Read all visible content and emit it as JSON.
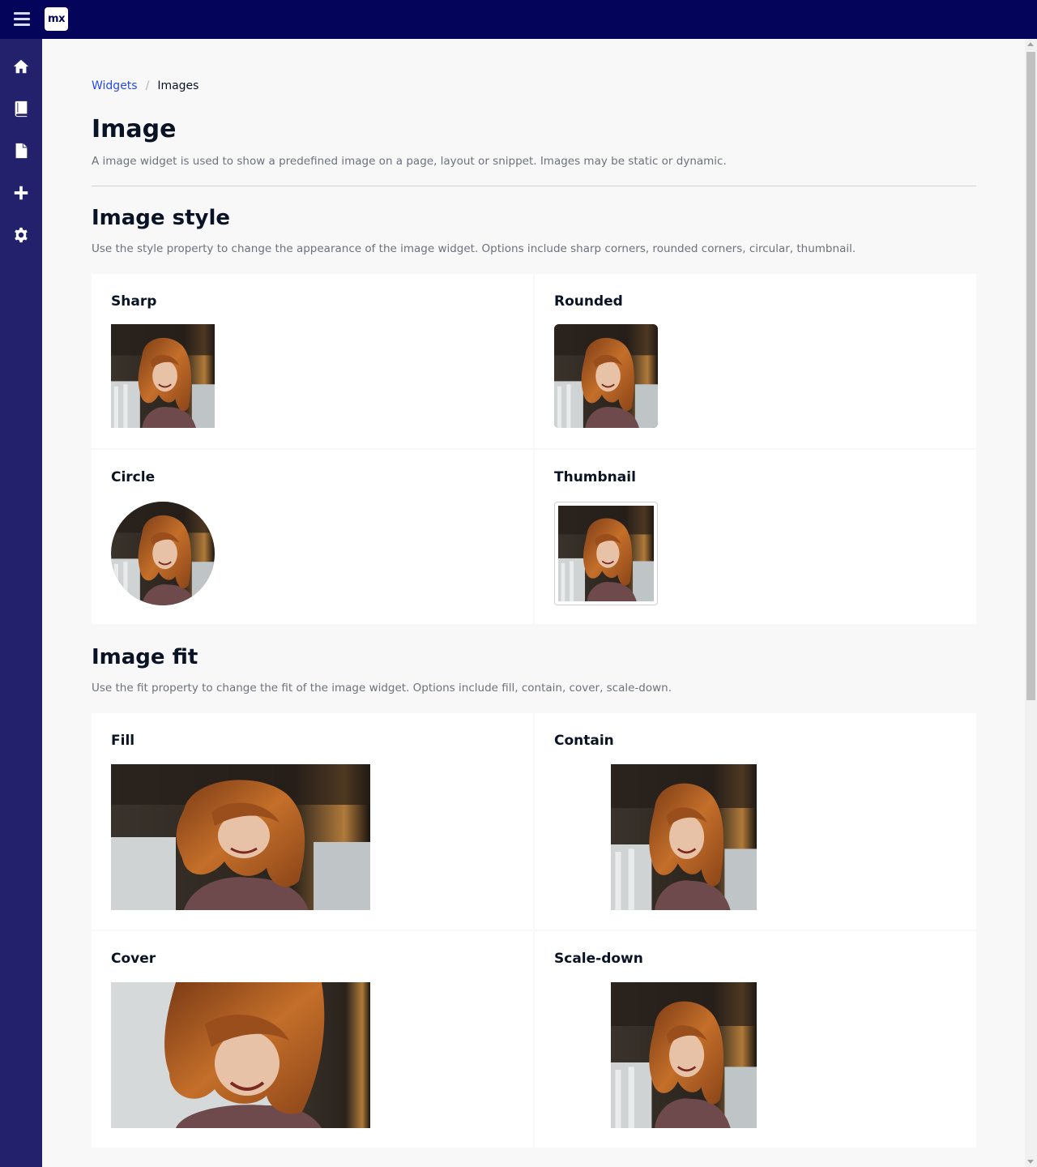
{
  "topbar": {
    "logo_text": "mx",
    "menu_icon": "hamburger-menu-icon"
  },
  "sidebar": {
    "items": [
      {
        "name": "home",
        "icon": "home-icon"
      },
      {
        "name": "book",
        "icon": "book-icon"
      },
      {
        "name": "file",
        "icon": "file-icon"
      },
      {
        "name": "add",
        "icon": "plus-icon"
      },
      {
        "name": "settings",
        "icon": "gear-icon"
      }
    ]
  },
  "breadcrumb": {
    "parent": "Widgets",
    "separator": "/",
    "current": "Images"
  },
  "page": {
    "title": "Image",
    "description": "A image widget is used to show a predefined image on a page, layout or snippet. Images may be static or dynamic."
  },
  "sections": {
    "style": {
      "title": "Image style",
      "description": "Use the style property to change the appearance of the image widget. Options include sharp corners, rounded corners, circular, thumbnail.",
      "cards": [
        "Sharp",
        "Rounded",
        "Circle",
        "Thumbnail"
      ]
    },
    "fit": {
      "title": "Image fit",
      "description": "Use the fit property to change the fit of the image widget. Options include fill, contain, cover, scale-down.",
      "cards": [
        "Fill",
        "Contain",
        "Cover",
        "Scale-down"
      ]
    }
  },
  "colors": {
    "topbar": "#03045a",
    "sidebar": "#23216b",
    "link": "#264ae5"
  }
}
